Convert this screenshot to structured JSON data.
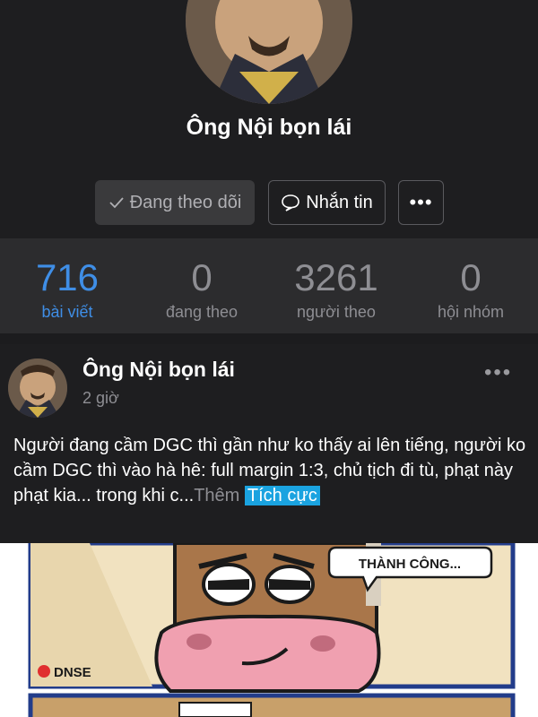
{
  "profile": {
    "name": "Ông Nội bọn lái",
    "buttons": {
      "following": "Đang theo dõi",
      "message": "Nhắn tin",
      "more": "•••"
    }
  },
  "stats": [
    {
      "value": "716",
      "label": "bài viết",
      "active": true
    },
    {
      "value": "0",
      "label": "đang theo",
      "active": false
    },
    {
      "value": "3261",
      "label": "người theo",
      "active": false
    },
    {
      "value": "0",
      "label": "hội nhóm",
      "active": false
    }
  ],
  "post": {
    "author": "Ông Nội bọn lái",
    "time": "2 giờ",
    "more": "•••",
    "text": "Người đang cầm DGC thì gần như ko thấy ai lên tiếng, người ko cầm DGC thì vào hà hê: full margin 1:3, chủ tịch đi tù, phạt này phạt kia... trong khi c...",
    "more_link": "Thêm",
    "sentiment": "Tích cực",
    "image": {
      "speech_text": "THÀNH CÔNG...",
      "brand": "DNSE"
    }
  },
  "colors": {
    "accent": "#3f8ee6",
    "sentiment_bg": "#1aa3e0",
    "background": "#1c1c1e"
  }
}
